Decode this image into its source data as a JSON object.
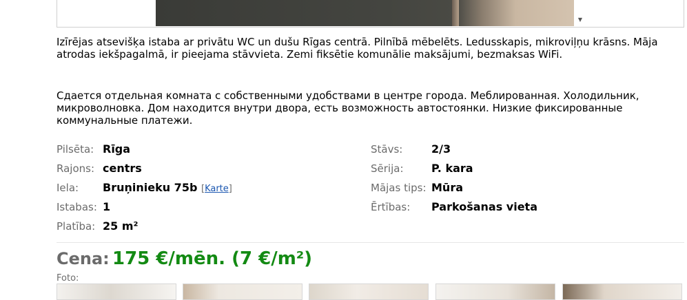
{
  "description": {
    "lv": "Izīrējas atsevišķa istaba ar privātu WC un dušu Rīgas centrā. Pilnībā mēbelēts. Ledusskapis, mikroviļņu krāsns. Māja atrodas iekšpagalmā, ir pieejama stāvvieta. Zemi fiksētie komunālie maksājumi, bezmaksas WiFi.",
    "ru": "Сдается отдельная комната с собственными удобствами в центре города. Меблированная. Холодильник, микроволновка. Дом находится внутри двора, есть возможность автостоянки. Низкие фиксированные коммунальные платежи."
  },
  "properties": {
    "left": [
      {
        "label": "Pilsēta:",
        "value": "Rīga"
      },
      {
        "label": "Rajons:",
        "value": "centrs"
      },
      {
        "label": "Iela:",
        "value": "Bruņinieku 75b"
      },
      {
        "label": "Istabas:",
        "value": "1"
      },
      {
        "label": "Platība:",
        "value": "25 m²"
      }
    ],
    "right": [
      {
        "label": "Stāvs:",
        "value": "2/3"
      },
      {
        "label": "Sērija:",
        "value": "P. kara"
      },
      {
        "label": "Mājas tips:",
        "value": "Mūra"
      },
      {
        "label": "Ērtības:",
        "value": "Parkošanas vieta"
      }
    ],
    "map_link": "Karte"
  },
  "price": {
    "label": "Cena:",
    "value": "175 €/mēn. (7 €/m²)"
  },
  "photos": {
    "label": "Foto:",
    "count": 5
  },
  "colors": {
    "price": "#138a13",
    "label": "#6b6b6b",
    "link": "#1a56b0"
  },
  "icons": {
    "scroll": "chevron-down-icon"
  }
}
